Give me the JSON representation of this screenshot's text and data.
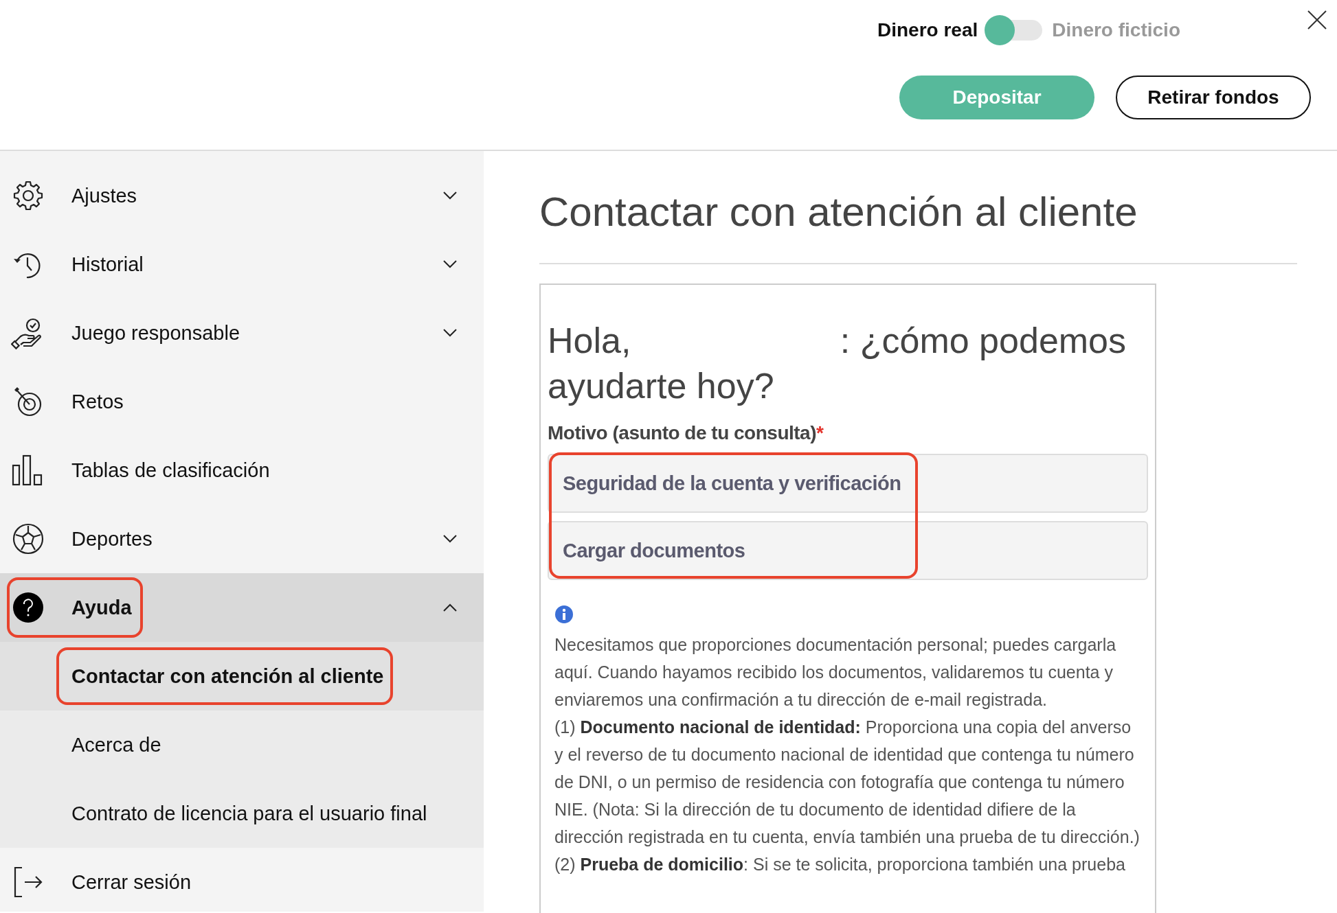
{
  "header": {
    "mode_toggle": {
      "options": [
        {
          "label": "Dinero real",
          "selected": true
        },
        {
          "label": "Dinero ficticio",
          "selected": false
        }
      ]
    },
    "buttons": [
      {
        "label": "Depositar",
        "kind": "primary"
      },
      {
        "label": "Retirar fondos",
        "kind": "outline"
      }
    ]
  },
  "sidebar": {
    "items": [
      {
        "label": "Ajustes",
        "kind": "group",
        "expanded": false,
        "selected": false,
        "highlighted": false
      },
      {
        "label": "Historial",
        "kind": "group",
        "expanded": false,
        "selected": false,
        "highlighted": false
      },
      {
        "label": "Juego responsable",
        "kind": "group",
        "expanded": false,
        "selected": false,
        "highlighted": false
      },
      {
        "label": "Retos",
        "kind": "link",
        "selected": false,
        "highlighted": false
      },
      {
        "label": "Tablas de clasificación",
        "kind": "link",
        "selected": false,
        "highlighted": false
      },
      {
        "label": "Deportes",
        "kind": "group",
        "expanded": false,
        "selected": false,
        "highlighted": false
      },
      {
        "label": "Ayuda",
        "kind": "group",
        "expanded": true,
        "selected": true,
        "highlighted": true,
        "children": [
          {
            "label": "Contactar con atención al cliente",
            "selected": true,
            "highlighted": true
          },
          {
            "label": "Acerca de",
            "selected": false,
            "highlighted": false
          },
          {
            "label": "Contrato de licencia para el usuario final",
            "selected": false,
            "highlighted": false
          }
        ]
      },
      {
        "label": "Cerrar sesión",
        "kind": "link",
        "selected": false,
        "highlighted": false
      }
    ]
  },
  "main": {
    "title": "Contactar con atención al cliente",
    "form": {
      "greeting_start": "Hola,",
      "greeting_end": ": ¿cómo podemos ayudarte hoy?",
      "reason_label": "Motivo (asunto de tu consulta)",
      "required_mark": "*",
      "options": [
        "Seguridad de la cuenta y verificación",
        "Cargar documentos"
      ],
      "options_highlighted": true,
      "info_paragraphs": [
        "Necesitamos que proporciones documentación personal; puedes cargarla aquí. Cuando hayamos recibido los documentos, validaremos tu cuenta y enviaremos una confirmación a tu dirección de e-mail registrada.",
        "(1) **Documento nacional de identidad:** Proporciona una copia del anverso y el reverso de tu documento nacional de identidad que contenga tu número de DNI, o un permiso de residencia con fotografía que contenga tu número NIE. (Nota: Si la dirección de tu documento de identidad difiere de la dirección registrada en tu cuenta, envía también una prueba de tu dirección.)",
        "(2) **Prueba de domicilio**: Si se te solicita, proporciona también una prueba"
      ]
    }
  }
}
